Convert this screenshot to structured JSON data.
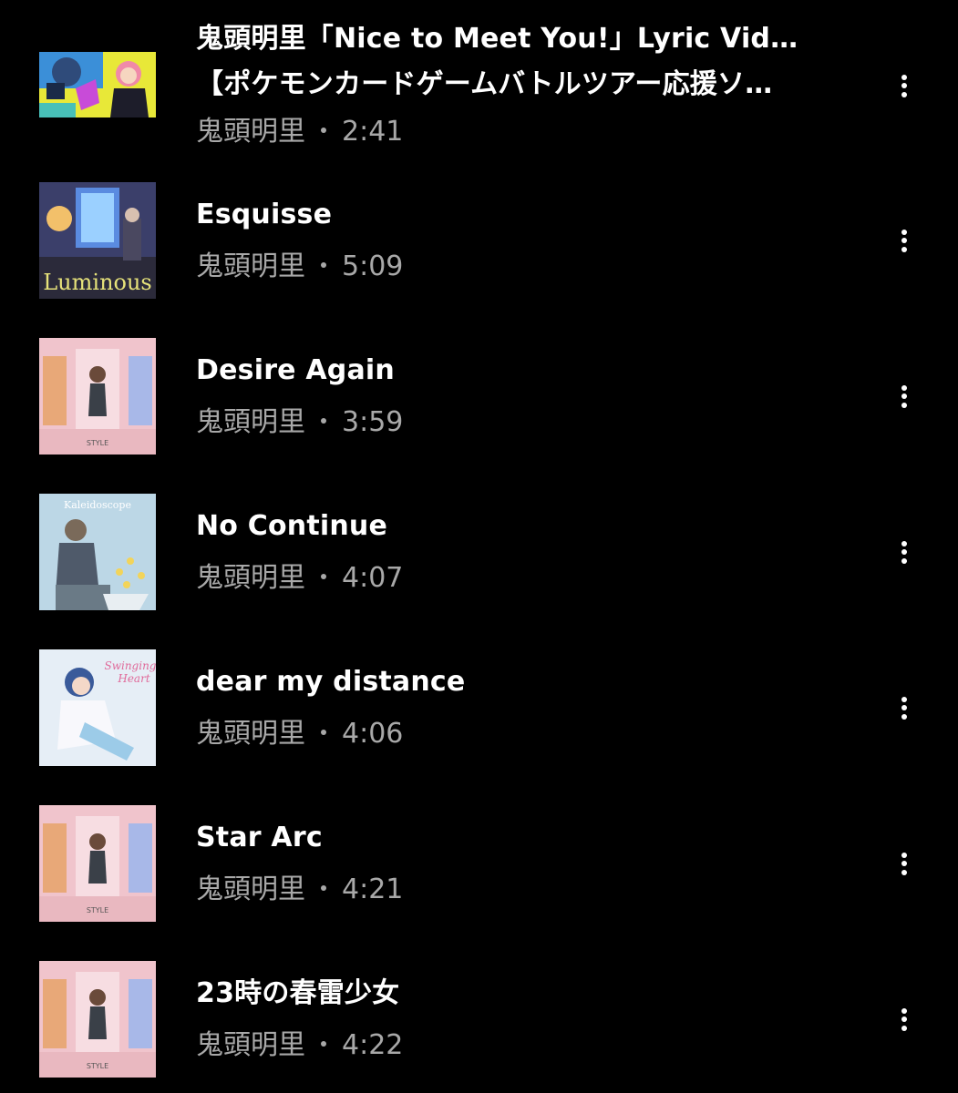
{
  "tracks": [
    {
      "title_line1": "鬼頭明里「Nice to Meet You!」Lyric Video",
      "title_line2": "【ポケモンカードゲームバトルツアー応援ソ…",
      "artist": "鬼頭明里",
      "duration": "2:41",
      "thumb": "pokemon-lyric-video"
    },
    {
      "title": "Esquisse",
      "artist": "鬼頭明里",
      "duration": "5:09",
      "thumb": "luminous-cover",
      "thumb_text": "Luminous"
    },
    {
      "title": "Desire Again",
      "artist": "鬼頭明里",
      "duration": "3:59",
      "thumb": "style-cover",
      "thumb_text": "STYLE"
    },
    {
      "title": "No Continue",
      "artist": "鬼頭明里",
      "duration": "4:07",
      "thumb": "kaleidoscope-cover",
      "thumb_text": "Kaleidoscope"
    },
    {
      "title": "dear my distance",
      "artist": "鬼頭明里",
      "duration": "4:06",
      "thumb": "swinging-heart-cover",
      "thumb_text_1": "Swinging",
      "thumb_text_2": "Heart"
    },
    {
      "title": "Star Arc",
      "artist": "鬼頭明里",
      "duration": "4:21",
      "thumb": "style-cover",
      "thumb_text": "STYLE"
    },
    {
      "title": "23時の春雷少女",
      "artist": "鬼頭明里",
      "duration": "4:22",
      "thumb": "style-cover",
      "thumb_text": "STYLE"
    }
  ],
  "colors": {
    "background": "#000000",
    "title": "#ffffff",
    "meta": "#a8a8a8"
  },
  "icons": {
    "more": "more-vertical-icon"
  }
}
